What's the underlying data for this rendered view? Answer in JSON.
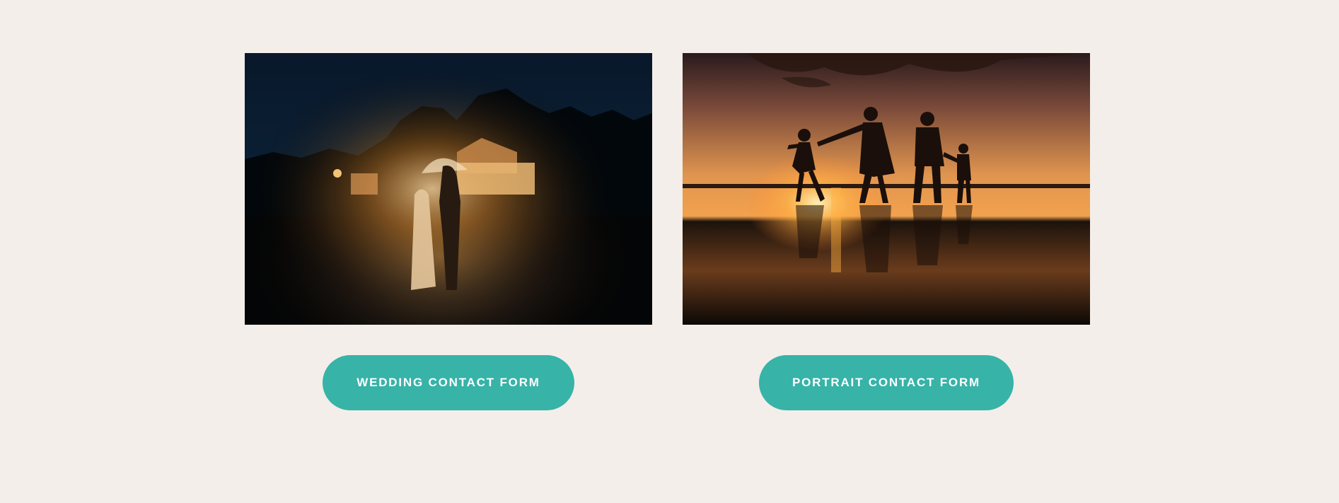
{
  "cards": [
    {
      "image_alt": "Bride and groom under a clear umbrella in the rain at night",
      "button_label": "WEDDING CONTACT FORM"
    },
    {
      "image_alt": "Family silhouette holding hands on the beach at sunset",
      "button_label": "PORTRAIT CONTACT FORM"
    }
  ],
  "colors": {
    "background": "#f3eee9",
    "button": "#37b3a8",
    "button_text": "#ffffff"
  }
}
